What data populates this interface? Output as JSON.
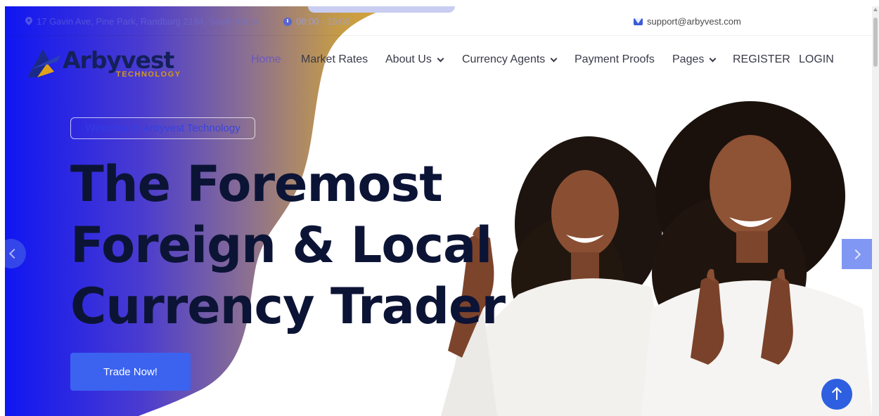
{
  "topbar": {
    "address": "17 Gavin Ave, Pine Park, Randburg 2194, South Africa",
    "hours": "08:00 - 15:00",
    "email": "support@arbyvest.com"
  },
  "brand": {
    "name": "Arbyvest",
    "tagline": "TECHNOLOGY"
  },
  "nav": {
    "items": [
      {
        "label": "Home",
        "dropdown": false,
        "active": true
      },
      {
        "label": "Market Rates",
        "dropdown": false
      },
      {
        "label": "About Us",
        "dropdown": true
      },
      {
        "label": "Currency Agents",
        "dropdown": true
      },
      {
        "label": "Payment Proofs",
        "dropdown": false
      },
      {
        "label": "Pages",
        "dropdown": true
      },
      {
        "label": "REGISTER",
        "dropdown": false
      },
      {
        "label": "LOGIN",
        "dropdown": false
      }
    ]
  },
  "hero": {
    "badge": "Welcome to Arbyvest Technology",
    "headline_lines": [
      "The Foremost",
      "Foreign & Local",
      "Currency Trader"
    ],
    "cta_label": "Trade Now!"
  },
  "colors": {
    "gradient_start": "#1018f0",
    "gradient_mid": "#7a6aa8",
    "gradient_end": "#c9a042",
    "primary": "#3b63f0",
    "headline": "#0c1436"
  },
  "icons": {
    "address": "map-pin-icon",
    "hours": "clock-icon",
    "email": "mail-icon",
    "prev": "chevron-left-icon",
    "next": "chevron-right-icon",
    "scroll_top": "arrow-up-icon"
  }
}
